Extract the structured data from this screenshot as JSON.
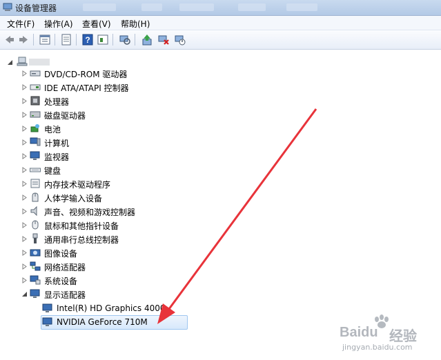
{
  "window": {
    "title": "设备管理器"
  },
  "menu": [
    {
      "label": "文件(F)"
    },
    {
      "label": "操作(A)"
    },
    {
      "label": "查看(V)"
    },
    {
      "label": "帮助(H)"
    }
  ],
  "toolbar": {
    "buttons": [
      "back-icon",
      "forward-icon",
      "properties-icon",
      "help-icon",
      "view-icon",
      "scan-icon",
      "update-driver-icon",
      "uninstall-icon",
      "disable-icon"
    ]
  },
  "tree": {
    "root_label": "",
    "categories": [
      {
        "label": "DVD/CD-ROM 驱动器",
        "icon": "dvd-drive-icon"
      },
      {
        "label": "IDE ATA/ATAPI 控制器",
        "icon": "ide-controller-icon"
      },
      {
        "label": "处理器",
        "icon": "processor-icon"
      },
      {
        "label": "磁盘驱动器",
        "icon": "disk-drive-icon"
      },
      {
        "label": "电池",
        "icon": "battery-icon"
      },
      {
        "label": "计算机",
        "icon": "computer-icon"
      },
      {
        "label": "监视器",
        "icon": "monitor-icon"
      },
      {
        "label": "键盘",
        "icon": "keyboard-icon"
      },
      {
        "label": "内存技术驱动程序",
        "icon": "memory-tech-icon"
      },
      {
        "label": "人体学输入设备",
        "icon": "hid-icon"
      },
      {
        "label": "声音、视频和游戏控制器",
        "icon": "sound-icon"
      },
      {
        "label": "鼠标和其他指针设备",
        "icon": "mouse-icon"
      },
      {
        "label": "通用串行总线控制器",
        "icon": "usb-icon"
      },
      {
        "label": "图像设备",
        "icon": "imaging-icon"
      },
      {
        "label": "网络适配器",
        "icon": "network-icon"
      },
      {
        "label": "系统设备",
        "icon": "system-icon"
      },
      {
        "label": "显示适配器",
        "icon": "display-adapter-icon"
      }
    ],
    "display_children": [
      {
        "label": "Intel(R) HD Graphics 4000"
      },
      {
        "label": "NVIDIA GeForce 710M",
        "selected": true
      }
    ]
  },
  "watermark": {
    "brand": "Baidu",
    "brand_cn": "经验",
    "url": "jingyan.baidu.com"
  },
  "colors": {
    "accent": "#e8333a",
    "selection": "#d7e8fb"
  }
}
